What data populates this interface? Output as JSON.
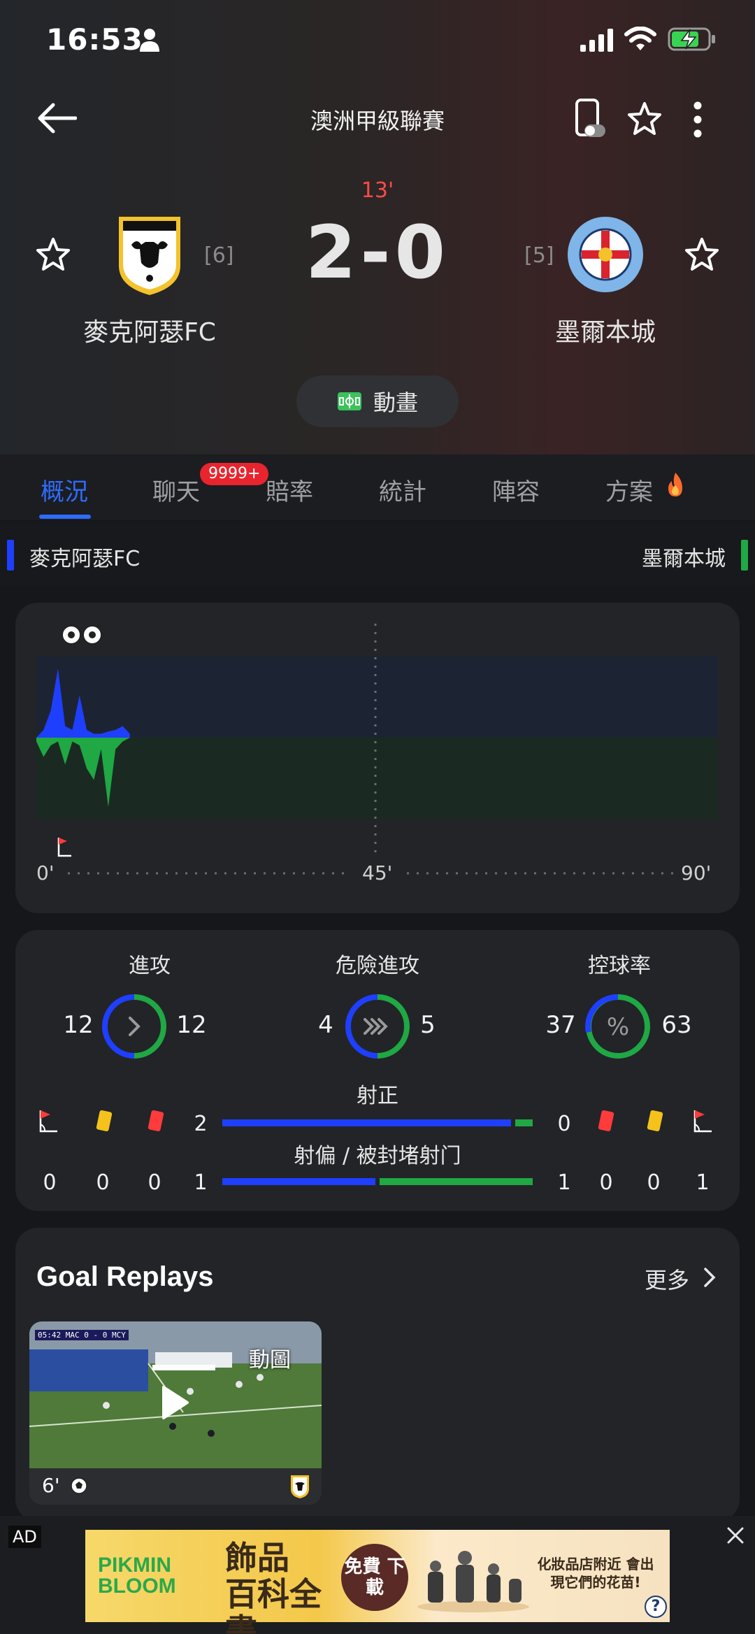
{
  "status_bar": {
    "time": "16:53"
  },
  "header": {
    "league": "澳洲甲級聯賽"
  },
  "match": {
    "minute": "13'",
    "score": "2-0",
    "home": {
      "name": "麥克阿瑟FC",
      "rank": "[6]"
    },
    "away": {
      "name": "墨爾本城",
      "rank": "[5]"
    },
    "animation_label": "動畫"
  },
  "tabs": {
    "items": [
      "概況",
      "聊天",
      "賠率",
      "統計",
      "陣容",
      "方案"
    ],
    "active": "概況",
    "chat_badge": "9999+"
  },
  "team_bar": {
    "home": "麥克阿瑟FC",
    "away": "墨爾本城"
  },
  "timeline": {
    "axis": [
      "0'",
      "45'",
      "90'"
    ]
  },
  "chart_data": {
    "type": "area",
    "title": "",
    "xlabel": "",
    "ylabel": "",
    "x_ticks": [
      "0'",
      "45'",
      "90'"
    ],
    "xlim": [
      0,
      90
    ],
    "events": [
      {
        "type": "goal",
        "minute": 2.5
      },
      {
        "type": "goal",
        "minute": 6
      },
      {
        "type": "corner",
        "minute": 2
      }
    ],
    "series": [
      {
        "team": "home",
        "x": [
          0,
          1,
          2,
          3,
          4,
          5,
          6,
          7,
          8,
          9,
          10,
          11,
          12,
          13
        ],
        "values": [
          0,
          0.1,
          0.35,
          0.9,
          0.15,
          0.1,
          0.55,
          0.1,
          0.05,
          0.05,
          0.08,
          0.1,
          0.15,
          0.05
        ]
      },
      {
        "team": "away",
        "x": [
          0,
          1,
          2,
          3,
          4,
          5,
          6,
          7,
          8,
          9,
          10,
          11,
          12,
          13
        ],
        "values": [
          0.05,
          0.25,
          0.1,
          0.05,
          0.35,
          0.05,
          0.1,
          0.4,
          0.55,
          0.15,
          0.9,
          0.15,
          0.05,
          0
        ]
      }
    ]
  },
  "stats": {
    "attack": {
      "label": "進攻",
      "home": 12,
      "away": 12
    },
    "dangerous_attack": {
      "label": "危險進攻",
      "home": 4,
      "away": 5
    },
    "possession": {
      "label": "控球率",
      "home": 37,
      "away": 63,
      "icon_text": "%"
    },
    "shots_on_target": {
      "label": "射正",
      "home": 2,
      "away": 0
    },
    "shots_off_blocked": {
      "label": "射偏 / 被封堵射门",
      "home": 1,
      "away": 1
    },
    "home_corners": 0,
    "home_yellow": 0,
    "home_red": 0,
    "away_red": 0,
    "away_yellow": 0,
    "away_corners": 1
  },
  "replays": {
    "title": "Goal Replays",
    "more_label": "更多",
    "items": [
      {
        "tag": "動圖",
        "minute": "6'",
        "overlay": "05:42  MAC  0 - 0  MCY"
      }
    ]
  },
  "colors": {
    "accent": "#2f6bff",
    "home": "#1f3fff",
    "away": "#1fa843",
    "live_red": "#ff4a4a"
  },
  "ad": {
    "label": "AD",
    "brand": "PIKMIN BLOOM",
    "headline": "飾品 百科全書",
    "cta": "免費 下載",
    "side_text": "化妝品店附近 會出現它們的花苗!",
    "help": "?"
  }
}
